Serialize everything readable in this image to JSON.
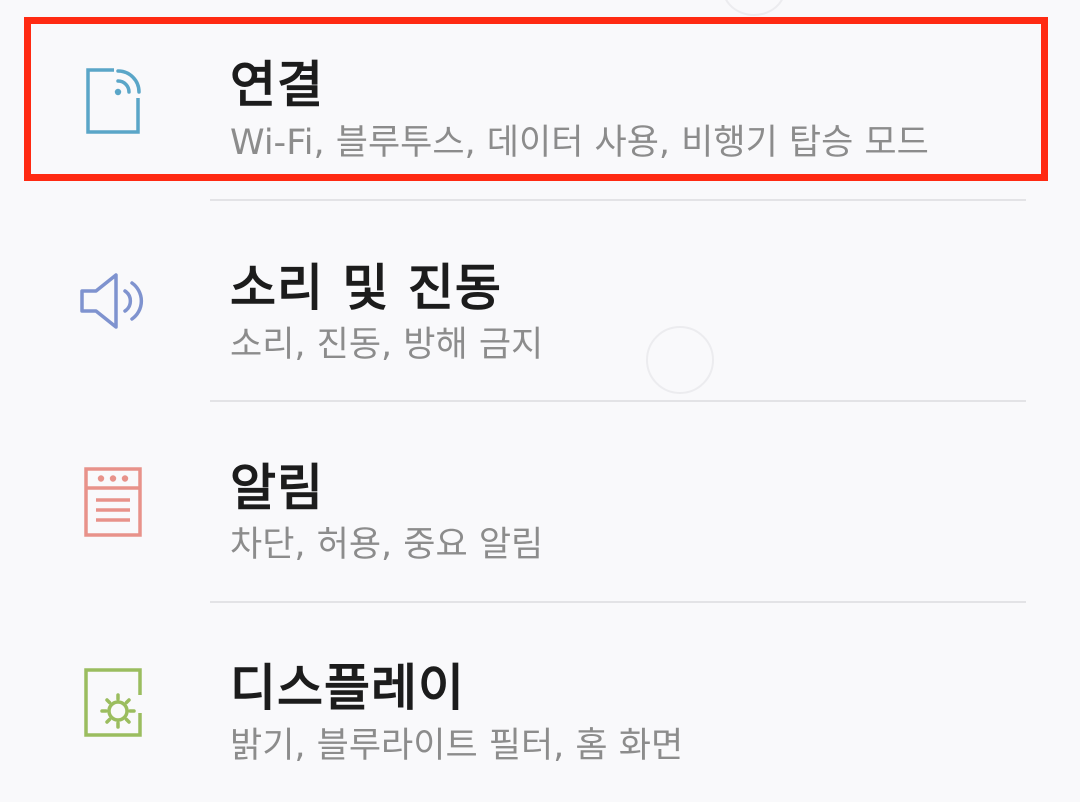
{
  "settings": {
    "items": [
      {
        "title": "연결",
        "subtitle": "Wi-Fi, 블루투스, 데이터 사용, 비행기 탑승 모드",
        "icon": "connections-icon",
        "icon_color": "#5aa6c8"
      },
      {
        "title": "소리 및 진동",
        "subtitle": "소리, 진동, 방해 금지",
        "icon": "speaker-icon",
        "icon_color": "#7f93cf"
      },
      {
        "title": "알림",
        "subtitle": "차단, 허용, 중요 알림",
        "icon": "notifications-icon",
        "icon_color": "#e8928a"
      },
      {
        "title": "디스플레이",
        "subtitle": "밝기, 블루라이트 필터, 홈 화면",
        "icon": "display-brightness-icon",
        "icon_color": "#9bbd5f"
      }
    ]
  },
  "highlight": {
    "color": "#ff2a12",
    "target": "connections"
  }
}
